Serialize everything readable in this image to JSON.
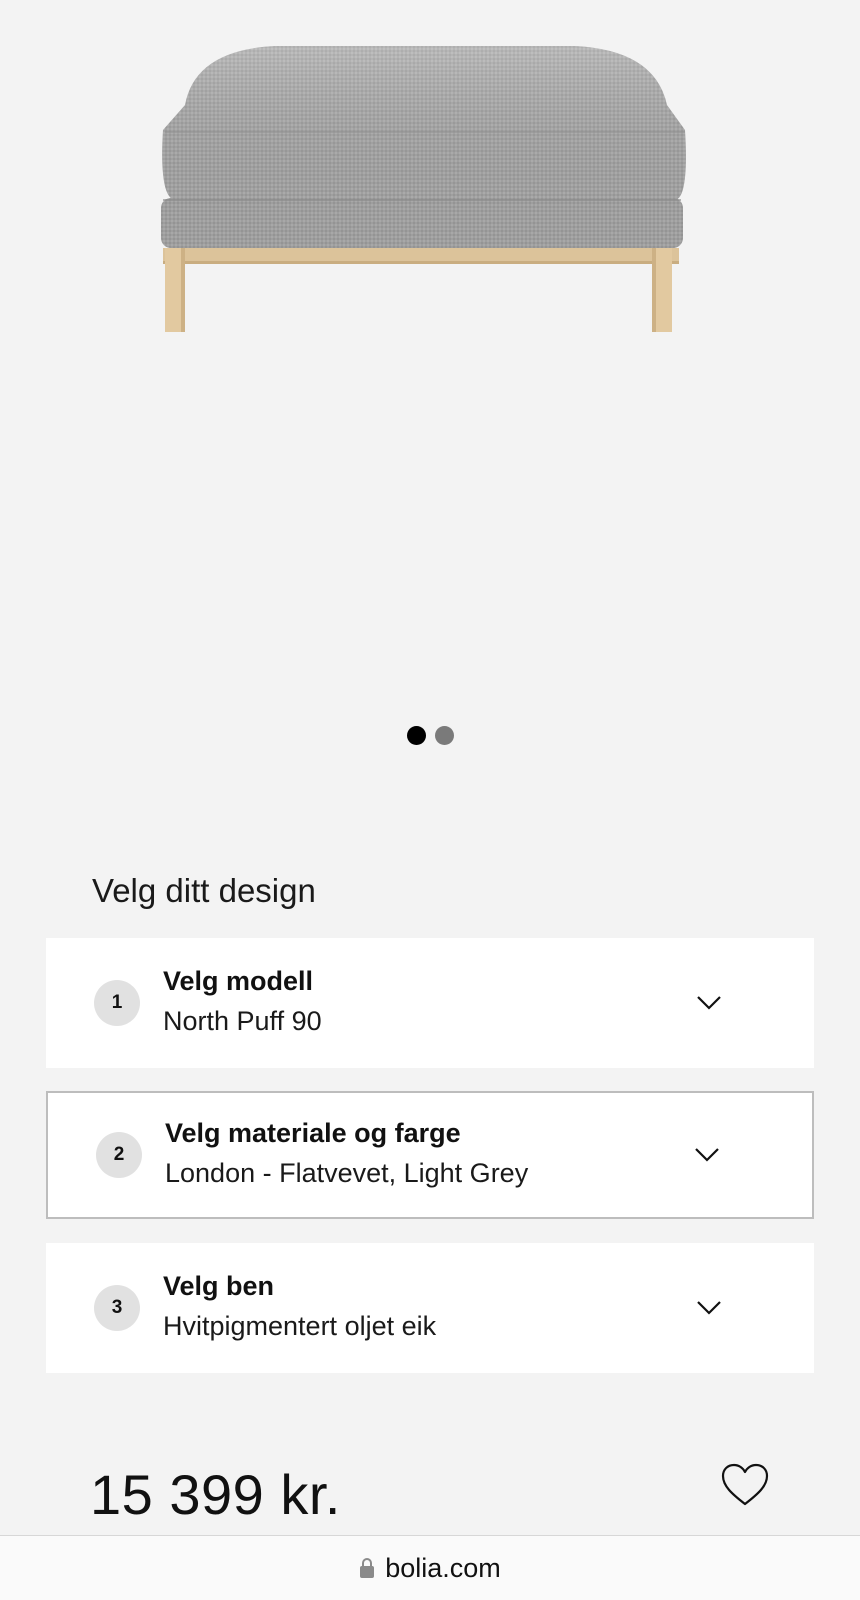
{
  "product": {
    "image": "north-puff-ottoman-light-grey"
  },
  "carousel": {
    "total": 2,
    "active_index": 0
  },
  "configurator": {
    "title": "Velg ditt design",
    "steps": [
      {
        "number": "1",
        "title": "Velg modell",
        "value": "North Puff 90",
        "selected": false
      },
      {
        "number": "2",
        "title": "Velg materiale og farge",
        "value": "London - Flatvevet, Light Grey",
        "selected": true
      },
      {
        "number": "3",
        "title": "Velg ben",
        "value": "Hvitpigmentert oljet eik",
        "selected": false
      }
    ]
  },
  "price": "15 399 kr.",
  "favorite_icon": "heart-outline-icon",
  "browser": {
    "url": "bolia.com",
    "lock_icon": "lock-icon"
  },
  "colors": {
    "background": "#f3f3f3",
    "card": "#ffffff",
    "badge": "#e1e1e1",
    "dot_active": "#000000",
    "dot_inactive": "#7a7a7a"
  }
}
